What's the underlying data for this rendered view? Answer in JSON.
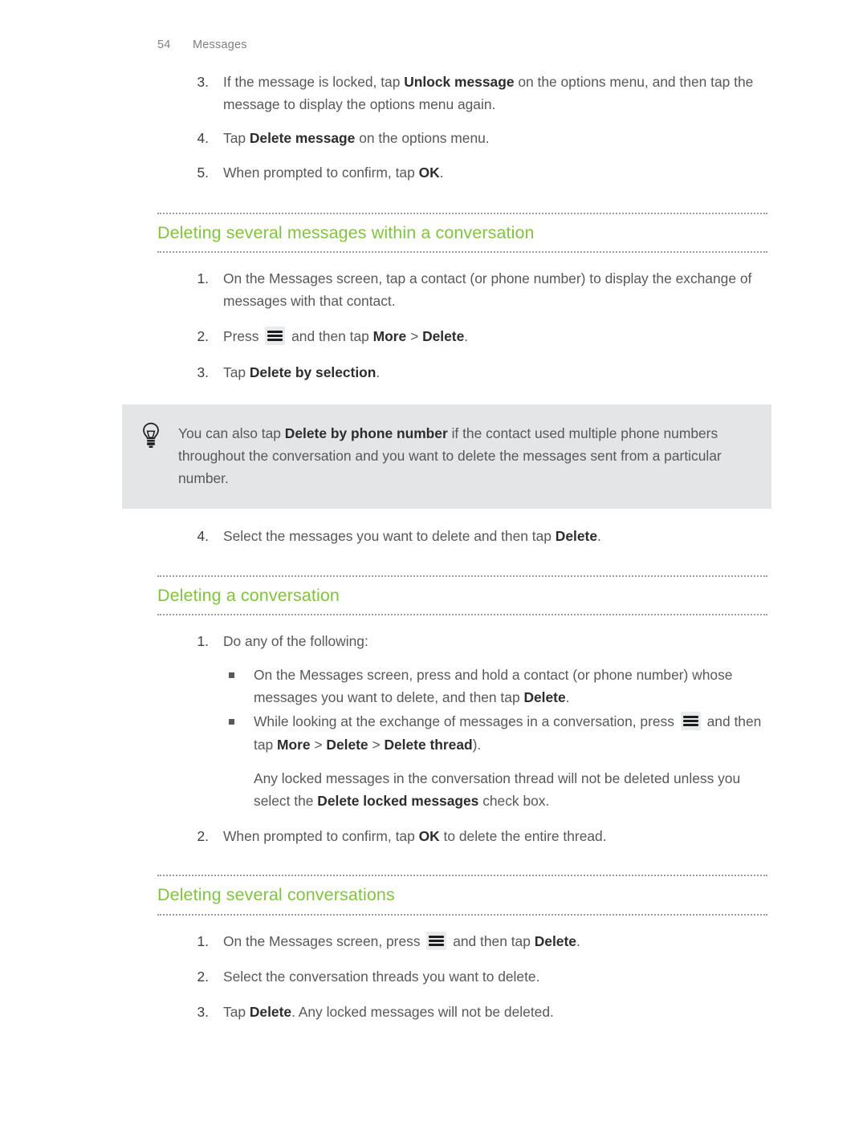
{
  "header": {
    "page_number": "54",
    "section": "Messages"
  },
  "colors": {
    "heading_green": "#82c341",
    "body_text": "#58585a",
    "bold_text": "#2d2d2f",
    "tip_background": "#e4e5e6",
    "rule_dotted": "#9b9b9e",
    "menu_key_background": "#e8eaeb"
  },
  "icons": {
    "menu_key": "menu-key-icon",
    "tip_bulb": "lightbulb-icon",
    "square_bullet": "square-bullet-icon"
  },
  "continued_list": {
    "items": [
      {
        "num": "3.",
        "parts": [
          {
            "t": "If the message is locked, tap "
          },
          {
            "t": "Unlock message",
            "b": true
          },
          {
            "t": " on the options menu, and then tap the message to display the options menu again."
          }
        ]
      },
      {
        "num": "4.",
        "parts": [
          {
            "t": "Tap "
          },
          {
            "t": "Delete message",
            "b": true
          },
          {
            "t": " on the options menu."
          }
        ]
      },
      {
        "num": "5.",
        "parts": [
          {
            "t": "When prompted to confirm, tap "
          },
          {
            "t": "OK",
            "b": true
          },
          {
            "t": "."
          }
        ]
      }
    ]
  },
  "sections": [
    {
      "heading": "Deleting several messages within a conversation",
      "items": [
        {
          "num": "1.",
          "parts": [
            {
              "t": "On the Messages screen, tap a contact (or phone number) to display the exchange of messages with that contact."
            }
          ]
        },
        {
          "num": "2.",
          "parts": [
            {
              "t": "Press "
            },
            {
              "icon": "menu-key"
            },
            {
              "t": " and then tap "
            },
            {
              "t": "More",
              "b": true
            },
            {
              "t": " > "
            },
            {
              "t": "Delete",
              "b": true
            },
            {
              "t": "."
            }
          ]
        },
        {
          "num": "3.",
          "parts": [
            {
              "t": "Tap "
            },
            {
              "t": "Delete by selection",
              "b": true
            },
            {
              "t": "."
            }
          ]
        }
      ],
      "tip": {
        "parts": [
          {
            "t": "You can also tap "
          },
          {
            "t": "Delete by phone number",
            "b": true
          },
          {
            "t": " if the contact used multiple phone numbers throughout the conversation and you want to delete the messages sent from a particular number."
          }
        ]
      },
      "items_after_tip": [
        {
          "num": "4.",
          "parts": [
            {
              "t": "Select the messages you want to delete and then tap "
            },
            {
              "t": "Delete",
              "b": true
            },
            {
              "t": "."
            }
          ]
        }
      ]
    },
    {
      "heading": "Deleting a conversation",
      "items": [
        {
          "num": "1.",
          "parts": [
            {
              "t": "Do any of the following:"
            }
          ],
          "bullets": [
            {
              "parts": [
                {
                  "t": "On the Messages screen, press and hold a contact (or phone number) whose messages you want to delete, and then tap "
                },
                {
                  "t": "Delete",
                  "b": true
                },
                {
                  "t": "."
                }
              ]
            },
            {
              "parts": [
                {
                  "t": "While looking at the exchange of messages in a conversation, press "
                },
                {
                  "icon": "menu-key"
                },
                {
                  "t": " and then tap "
                },
                {
                  "t": "More",
                  "b": true
                },
                {
                  "t": " > "
                },
                {
                  "t": "Delete",
                  "b": true
                },
                {
                  "t": " > "
                },
                {
                  "t": "Delete thread",
                  "b": true
                },
                {
                  "t": ")."
                }
              ]
            }
          ],
          "note": {
            "parts": [
              {
                "t": "Any locked messages in the conversation thread will not be deleted unless you select the "
              },
              {
                "t": "Delete locked messages",
                "b": true
              },
              {
                "t": " check box."
              }
            ]
          }
        },
        {
          "num": "2.",
          "parts": [
            {
              "t": "When prompted to confirm, tap "
            },
            {
              "t": "OK",
              "b": true
            },
            {
              "t": " to delete the entire thread."
            }
          ]
        }
      ]
    },
    {
      "heading": "Deleting several conversations",
      "items": [
        {
          "num": "1.",
          "parts": [
            {
              "t": "On the Messages screen, press "
            },
            {
              "icon": "menu-key"
            },
            {
              "t": " and then tap "
            },
            {
              "t": "Delete",
              "b": true
            },
            {
              "t": "."
            }
          ]
        },
        {
          "num": "2.",
          "parts": [
            {
              "t": "Select the conversation threads you want to delete."
            }
          ]
        },
        {
          "num": "3.",
          "parts": [
            {
              "t": "Tap "
            },
            {
              "t": "Delete",
              "b": true
            },
            {
              "t": ". Any locked messages will not be deleted."
            }
          ]
        }
      ]
    }
  ]
}
